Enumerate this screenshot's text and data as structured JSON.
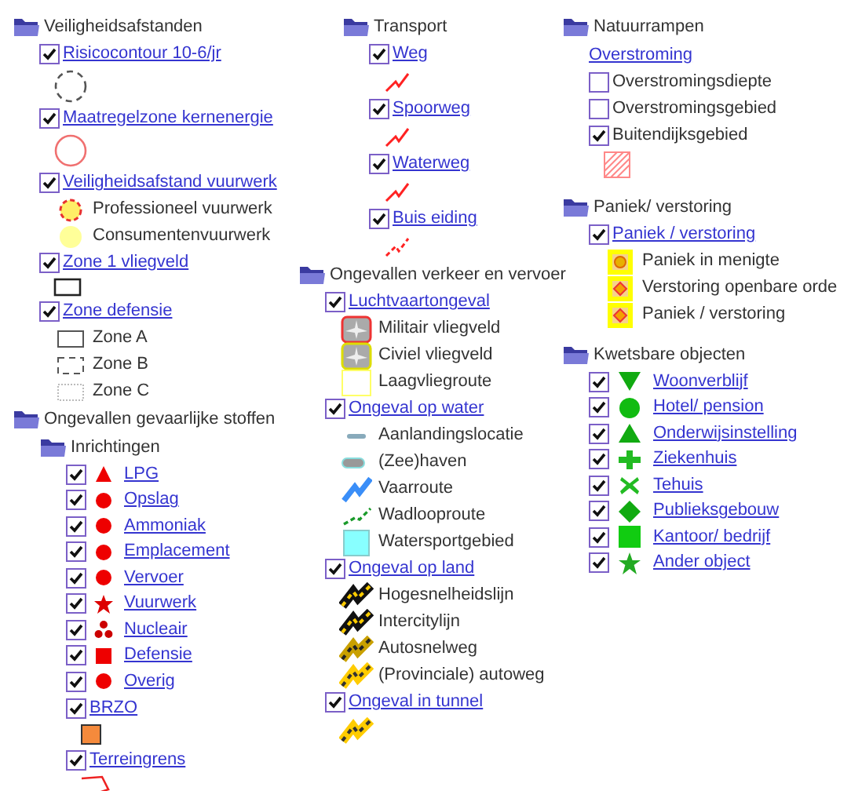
{
  "columns": [
    {
      "items": [
        {
          "kind": "folder",
          "label": "Veiligheidsafstanden",
          "children": [
            {
              "kind": "layer",
              "label": "Risicocontour 10-6/jr",
              "checked": true,
              "children": [
                {
                  "kind": "swatch"
                }
              ]
            },
            {
              "kind": "layer",
              "label": "Maatregelzone kernenergie",
              "checked": true,
              "children": [
                {
                  "kind": "swatch"
                }
              ]
            },
            {
              "kind": "layer",
              "label": "Veiligheidsafstand vuurwerk",
              "checked": true,
              "children": [
                {
                  "kind": "legend",
                  "label": "Professioneel vuurwerk"
                },
                {
                  "kind": "legend",
                  "label": "Consumentenvuurwerk"
                }
              ]
            },
            {
              "kind": "layer",
              "label": "Zone 1 vliegveld",
              "checked": true,
              "children": [
                {
                  "kind": "swatch"
                }
              ]
            },
            {
              "kind": "layer",
              "label": "Zone defensie",
              "checked": true,
              "children": [
                {
                  "kind": "legend",
                  "label": "Zone A"
                },
                {
                  "kind": "legend",
                  "label": "Zone B"
                },
                {
                  "kind": "legend",
                  "label": "Zone C"
                }
              ]
            }
          ]
        },
        {
          "kind": "folder",
          "label": "Ongevallen gevaarlijke stoffen",
          "children": [
            {
              "kind": "folder",
              "label": "Inrichtingen",
              "children": [
                {
                  "kind": "symbol_layer",
                  "label": "LPG",
                  "checked": true
                },
                {
                  "kind": "symbol_layer",
                  "label": "Opslag",
                  "checked": true
                },
                {
                  "kind": "symbol_layer",
                  "label": "Ammoniak",
                  "checked": true
                },
                {
                  "kind": "symbol_layer",
                  "label": "Emplacement",
                  "checked": true
                },
                {
                  "kind": "symbol_layer",
                  "label": "Vervoer",
                  "checked": true
                },
                {
                  "kind": "symbol_layer",
                  "label": "Vuurwerk",
                  "checked": true
                },
                {
                  "kind": "symbol_layer",
                  "label": "Nucleair",
                  "checked": true
                },
                {
                  "kind": "symbol_layer",
                  "label": "Defensie",
                  "checked": true
                },
                {
                  "kind": "symbol_layer",
                  "label": "Overig",
                  "checked": true
                },
                {
                  "kind": "layer",
                  "label": "BRZO",
                  "checked": true,
                  "children": [
                    {
                      "kind": "swatch"
                    }
                  ]
                },
                {
                  "kind": "layer",
                  "label": "Terreingrens",
                  "checked": true,
                  "children": [
                    {
                      "kind": "swatch"
                    }
                  ]
                }
              ]
            }
          ]
        }
      ]
    },
    {
      "items": [
        {
          "kind": "folder",
          "label": "Transport",
          "children": [
            {
              "kind": "layer",
              "label": "Weg",
              "checked": true,
              "children": [
                {
                  "kind": "swatch"
                }
              ]
            },
            {
              "kind": "layer",
              "label": "Spoorweg",
              "checked": true,
              "children": [
                {
                  "kind": "swatch"
                }
              ]
            },
            {
              "kind": "layer",
              "label": "Waterweg",
              "checked": true,
              "children": [
                {
                  "kind": "swatch"
                }
              ]
            },
            {
              "kind": "layer",
              "label": "Buis eiding",
              "checked": true,
              "children": [
                {
                  "kind": "swatch"
                }
              ]
            }
          ]
        },
        {
          "kind": "folder",
          "label": "Ongevallen verkeer en vervoer",
          "children": [
            {
              "kind": "layer",
              "label": "Luchtvaartongeval",
              "checked": true,
              "children": [
                {
                  "kind": "legend",
                  "label": "Militair vliegveld"
                },
                {
                  "kind": "legend",
                  "label": "Civiel vliegveld"
                },
                {
                  "kind": "legend",
                  "label": "Laagvliegroute"
                }
              ]
            },
            {
              "kind": "layer",
              "label": "Ongeval op water",
              "checked": true,
              "children": [
                {
                  "kind": "legend",
                  "label": "Aanlandingslocatie"
                },
                {
                  "kind": "legend",
                  "label": "(Zee)haven"
                },
                {
                  "kind": "legend",
                  "label": "Vaarroute"
                },
                {
                  "kind": "legend",
                  "label": "Wadlooproute"
                },
                {
                  "kind": "legend",
                  "label": "Watersportgebied"
                }
              ]
            },
            {
              "kind": "layer",
              "label": "Ongeval op land",
              "checked": true,
              "children": [
                {
                  "kind": "legend",
                  "label": "Hogesnelheidslijn"
                },
                {
                  "kind": "legend",
                  "label": "Intercitylijn"
                },
                {
                  "kind": "legend",
                  "label": "Autosnelweg"
                },
                {
                  "kind": "legend",
                  "label": "(Provinciale) autoweg"
                }
              ]
            },
            {
              "kind": "layer",
              "label": "Ongeval in tunnel",
              "checked": true,
              "children": [
                {
                  "kind": "swatch"
                }
              ]
            }
          ]
        }
      ]
    },
    {
      "items": [
        {
          "kind": "folder",
          "label": "Natuurrampen",
          "children": [
            {
              "kind": "link",
              "label": "Overstroming"
            },
            {
              "kind": "toggle",
              "label": "Overstromingsdiepte",
              "checked": false
            },
            {
              "kind": "toggle",
              "label": "Overstromingsgebied",
              "checked": false
            },
            {
              "kind": "toggle",
              "label": "Buitendijksgebied",
              "checked": true,
              "children": [
                {
                  "kind": "swatch"
                }
              ]
            }
          ]
        },
        {
          "kind": "folder",
          "label": "Paniek/ verstoring",
          "children": [
            {
              "kind": "layer",
              "label": "Paniek / verstoring",
              "checked": true,
              "children": [
                {
                  "kind": "legend",
                  "label": "Paniek in menigte"
                },
                {
                  "kind": "legend",
                  "label": "Verstoring openbare orde"
                },
                {
                  "kind": "legend",
                  "label": "Paniek / verstoring"
                }
              ]
            }
          ]
        },
        {
          "kind": "folder",
          "label": "Kwetsbare objecten",
          "children": [
            {
              "kind": "symbol_layer",
              "label": "Woonverblijf",
              "checked": true
            },
            {
              "kind": "symbol_layer",
              "label": "Hotel/ pension",
              "checked": true
            },
            {
              "kind": "symbol_layer",
              "label": "Onderwijsinstelling",
              "checked": true
            },
            {
              "kind": "symbol_layer",
              "label": "Ziekenhuis",
              "checked": true
            },
            {
              "kind": "symbol_layer",
              "label": "Tehuis",
              "checked": true
            },
            {
              "kind": "symbol_layer",
              "label": "Publieksgebouw",
              "checked": true
            },
            {
              "kind": "symbol_layer",
              "label": "Kantoor/ bedrijf",
              "checked": true
            },
            {
              "kind": "symbol_layer",
              "label": "Ander object",
              "checked": true
            }
          ]
        }
      ]
    }
  ]
}
